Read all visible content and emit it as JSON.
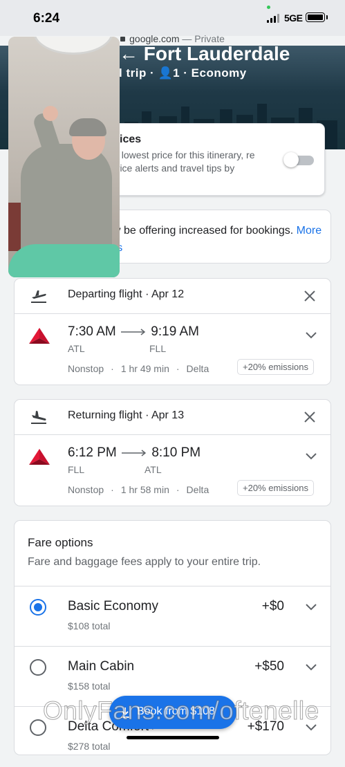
{
  "status_bar": {
    "time": "6:24",
    "network": "5GE"
  },
  "browser": {
    "domain": "google.com",
    "mode": "— Private"
  },
  "hero": {
    "title": "← Fort Lauderdale",
    "subtitle": "l trip · 👤1 · Economy"
  },
  "track_prices": {
    "title": "ices",
    "description": "le lowest price for this itinerary, re price alerts and travel tips by",
    "enabled": false
  },
  "notice": {
    "text": "e may be offering increased for bookings.",
    "link": "More details"
  },
  "flights": [
    {
      "header": "Departing flight · Apr 12",
      "depart_time": "7:30 AM",
      "arrive_time": "9:19 AM",
      "depart_airport": "ATL",
      "arrive_airport": "FLL",
      "stops": "Nonstop",
      "duration": "1 hr 49 min",
      "airline": "Delta",
      "emissions": "+20% emissions"
    },
    {
      "header": "Returning flight · Apr 13",
      "depart_time": "6:12 PM",
      "arrive_time": "8:10 PM",
      "depart_airport": "FLL",
      "arrive_airport": "ATL",
      "stops": "Nonstop",
      "duration": "1 hr 58 min",
      "airline": "Delta",
      "emissions": "+20% emissions"
    }
  ],
  "fares": {
    "title": "Fare options",
    "subtitle": "Fare and baggage fees apply to your entire trip.",
    "options": [
      {
        "name": "Basic Economy",
        "price": "+$0",
        "total": "$108 total",
        "selected": true
      },
      {
        "name": "Main Cabin",
        "price": "+$50",
        "total": "$158 total",
        "selected": false
      },
      {
        "name": "Delta Comfort+",
        "price": "+$170",
        "total": "$278 total",
        "selected": false
      }
    ]
  },
  "book_button": {
    "label": "Book from $108"
  },
  "watermark": "OnlyFans.com/oftenelle",
  "colors": {
    "accent": "#1a73e8",
    "delta_red": "#c8102e"
  }
}
